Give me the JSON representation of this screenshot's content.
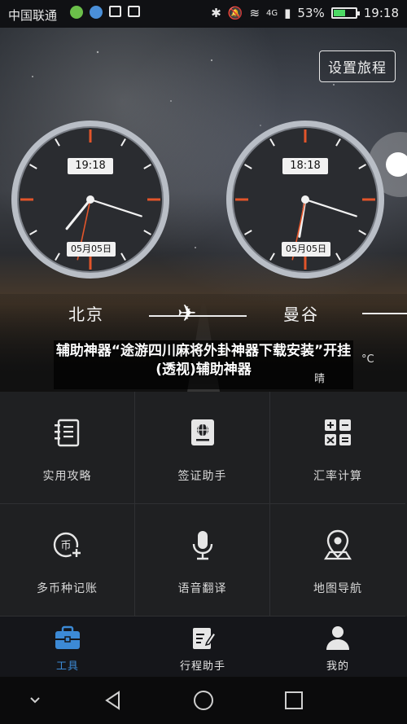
{
  "status_bar": {
    "carrier": "中国联通",
    "battery_percent": "53%",
    "battery_level": 0.53,
    "time": "19:18",
    "network": "4G"
  },
  "header": {
    "set_trip_label": "设置旅程"
  },
  "clocks": [
    {
      "time": "19:18",
      "date": "05月05日",
      "hour": 19,
      "minute": 18
    },
    {
      "time": "18:18",
      "date": "05月05日",
      "hour": 18,
      "minute": 18
    }
  ],
  "route": {
    "from_city": "北京",
    "to_city": "曼谷"
  },
  "weather_overlay": {
    "unit": "°C",
    "condition": "晴"
  },
  "ad_overlay": {
    "headline": "辅助神器“途游四川麻将外卦神器下载安装”开挂(透视)辅助神器"
  },
  "tools": [
    {
      "label": "实用攻略",
      "icon": "notebook-icon"
    },
    {
      "label": "签证助手",
      "icon": "passport-globe-icon"
    },
    {
      "label": "汇率计算",
      "icon": "calculator-icon"
    },
    {
      "label": "多币种记账",
      "icon": "currency-add-icon"
    },
    {
      "label": "语音翻译",
      "icon": "microphone-icon"
    },
    {
      "label": "地图导航",
      "icon": "map-pin-icon"
    }
  ],
  "tabs": [
    {
      "label": "工具",
      "icon": "toolbox-icon",
      "active": true
    },
    {
      "label": "行程助手",
      "icon": "edit-document-icon",
      "active": false
    },
    {
      "label": "我的",
      "icon": "person-icon",
      "active": false
    }
  ],
  "colors": {
    "accent_blue": "#3c8ad6",
    "clock_second_hand": "#e2552a"
  }
}
